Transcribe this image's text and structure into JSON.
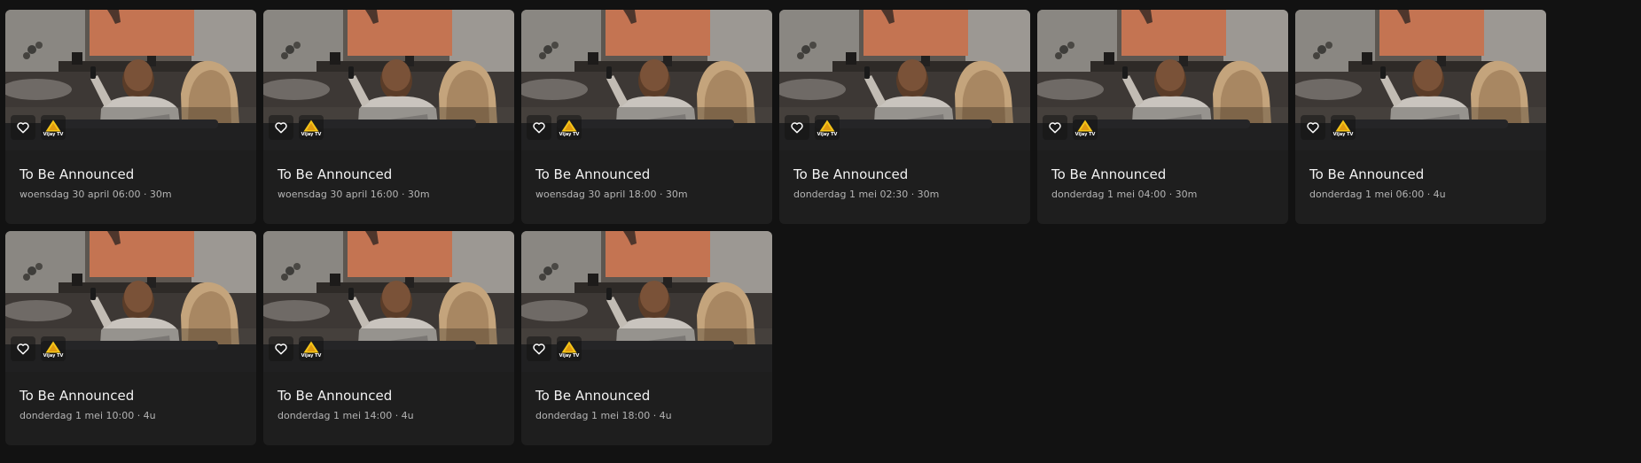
{
  "cards": [
    {
      "title": "To Be Announced",
      "schedule": "woensdag 30 april 06:00 · 30m",
      "channel": "Vijay TV"
    },
    {
      "title": "To Be Announced",
      "schedule": "woensdag 30 april 16:00 · 30m",
      "channel": "Vijay TV"
    },
    {
      "title": "To Be Announced",
      "schedule": "woensdag 30 april 18:00 · 30m",
      "channel": "Vijay TV"
    },
    {
      "title": "To Be Announced",
      "schedule": "donderdag 1 mei 02:30 · 30m",
      "channel": "Vijay TV"
    },
    {
      "title": "To Be Announced",
      "schedule": "donderdag 1 mei 04:00 · 30m",
      "channel": "Vijay TV"
    },
    {
      "title": "To Be Announced",
      "schedule": "donderdag 1 mei 06:00 · 4u",
      "channel": "Vijay TV"
    },
    {
      "title": "To Be Announced",
      "schedule": "donderdag 1 mei 10:00 · 4u",
      "channel": "Vijay TV"
    },
    {
      "title": "To Be Announced",
      "schedule": "donderdag 1 mei 14:00 · 4u",
      "channel": "Vijay TV"
    },
    {
      "title": "To Be Announced",
      "schedule": "donderdag 1 mei 18:00 · 4u",
      "channel": "Vijay TV"
    }
  ],
  "icons": {
    "favorite": "heart-outline-icon",
    "channel_logo": "vijay-tv-logo"
  },
  "colors": {
    "page_background": "#121212",
    "card_background": "#1e1e1e",
    "logo_accent": "#f5c518"
  }
}
